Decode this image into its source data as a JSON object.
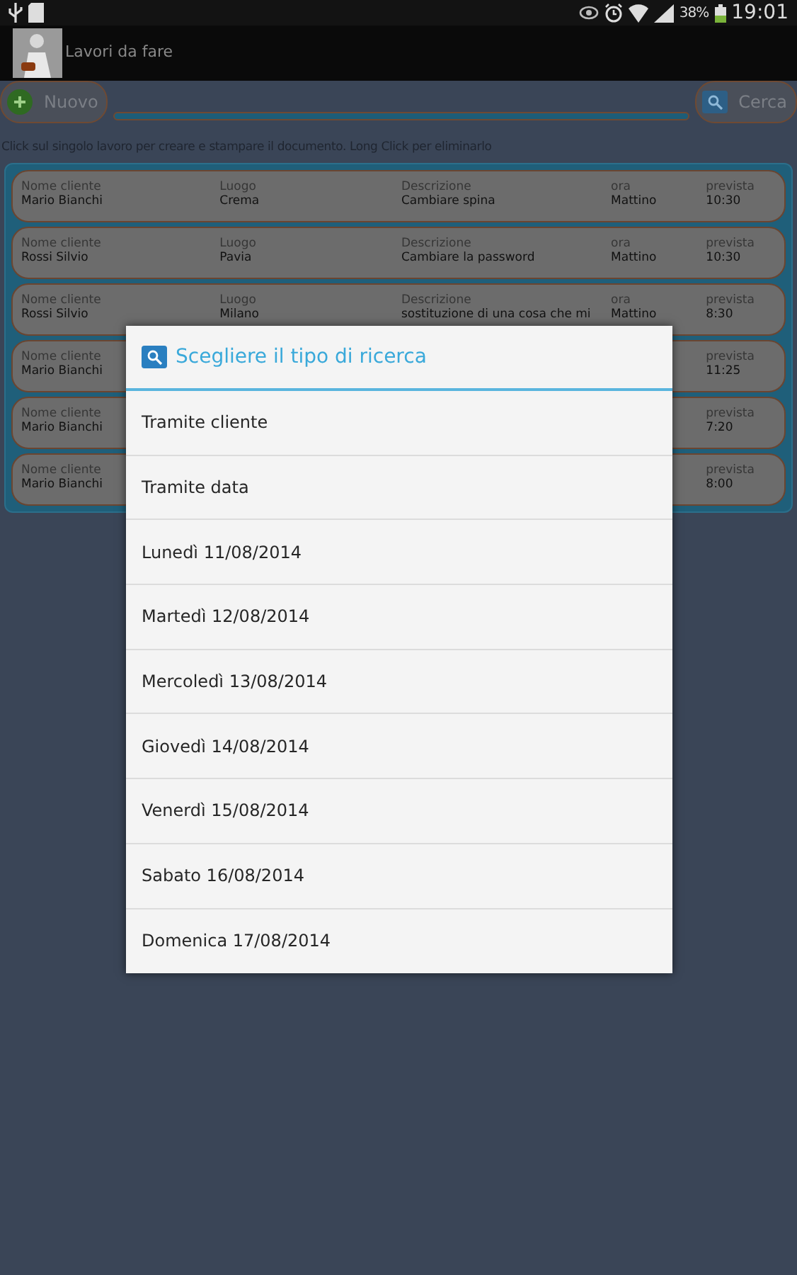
{
  "status_bar": {
    "battery": "38%",
    "time": "19:01"
  },
  "action_bar": {
    "title": "Lavori da fare"
  },
  "toolbar": {
    "new_button": "Nuovo",
    "search_button": "Cerca"
  },
  "hint": "Click sul singolo lavoro per creare e stampare il documento. Long Click per eliminarlo",
  "jobs": [
    {
      "cells": [
        {
          "label": "Nome cliente",
          "value": "Mario Bianchi"
        },
        {
          "label": "Luogo",
          "value": "Crema"
        },
        {
          "label": "Descrizione",
          "value": "Cambiare spina"
        },
        {
          "label": "ora",
          "value": "Mattino"
        },
        {
          "label": "prevista",
          "value": "10:30"
        }
      ]
    },
    {
      "cells": [
        {
          "label": "Nome cliente",
          "value": "Rossi Silvio"
        },
        {
          "label": "Luogo",
          "value": "Pavia"
        },
        {
          "label": "Descrizione",
          "value": "Cambiare la password"
        },
        {
          "label": "ora",
          "value": "Mattino"
        },
        {
          "label": "prevista",
          "value": "10:30"
        }
      ]
    },
    {
      "cells": [
        {
          "label": "Nome cliente",
          "value": "Rossi Silvio"
        },
        {
          "label": "Luogo",
          "value": "Milano"
        },
        {
          "label": "Descrizione",
          "value": "sostituzione di una cosa che mi"
        },
        {
          "label": "ora",
          "value": "Mattino"
        },
        {
          "label": "prevista",
          "value": "8:30"
        }
      ]
    },
    {
      "cells": [
        {
          "label": "Nome cliente",
          "value": "Mario Bianchi"
        },
        null,
        null,
        null,
        {
          "label": "prevista",
          "value": "11:25"
        }
      ]
    },
    {
      "cells": [
        {
          "label": "Nome cliente",
          "value": "Mario Bianchi"
        },
        null,
        null,
        null,
        {
          "label": "prevista",
          "value": "7:20"
        }
      ]
    },
    {
      "cells": [
        {
          "label": "Nome cliente",
          "value": "Mario Bianchi"
        },
        null,
        null,
        null,
        {
          "label": "prevista",
          "value": "8:00"
        }
      ]
    }
  ],
  "dialog": {
    "title": "Scegliere il tipo di ricerca",
    "options": [
      "Tramite cliente",
      "Tramite data",
      "Lunedì 11/08/2014",
      "Martedì 12/08/2014",
      "Mercoledì 13/08/2014",
      "Giovedì 14/08/2014",
      "Venerdì 15/08/2014",
      "Sabato 16/08/2014",
      "Domenica 17/08/2014"
    ]
  }
}
